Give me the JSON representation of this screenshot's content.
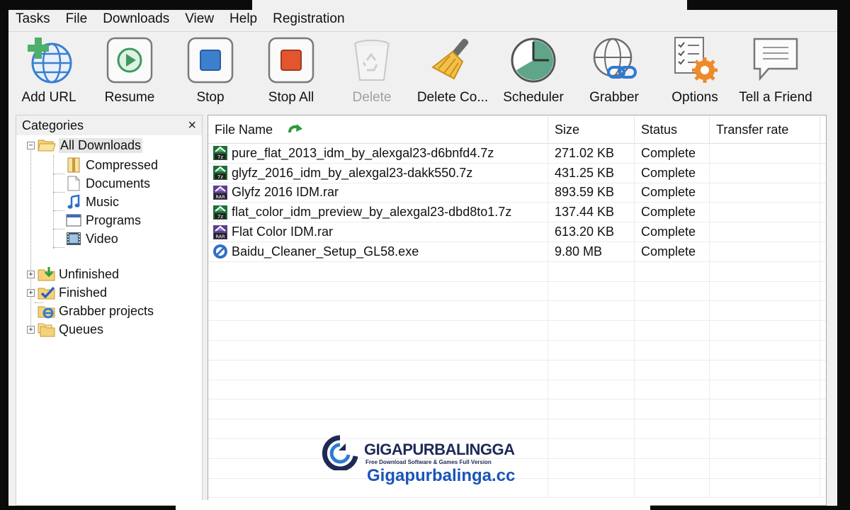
{
  "menu": [
    "Tasks",
    "File",
    "Downloads",
    "View",
    "Help",
    "Registration"
  ],
  "toolbar": [
    {
      "label": "Add URL",
      "icon": "add-url-globe-icon",
      "enabled": true
    },
    {
      "label": "Resume",
      "icon": "resume-play-icon",
      "enabled": true
    },
    {
      "label": "Stop",
      "icon": "stop-icon",
      "enabled": true
    },
    {
      "label": "Stop All",
      "icon": "stop-all-icon",
      "enabled": true
    },
    {
      "label": "Delete",
      "icon": "recycle-bin-icon",
      "enabled": false
    },
    {
      "label": "Delete Co...",
      "icon": "broom-icon",
      "enabled": true
    },
    {
      "label": "Scheduler",
      "icon": "clock-icon",
      "enabled": true
    },
    {
      "label": "Grabber",
      "icon": "globe-link-icon",
      "enabled": true
    },
    {
      "label": "Options",
      "icon": "checklist-gear-icon",
      "enabled": true
    },
    {
      "label": "Tell a Friend",
      "icon": "speech-bubble-icon",
      "enabled": true
    }
  ],
  "categories": {
    "title": "Categories",
    "close": "×",
    "items": [
      {
        "label": "All Downloads",
        "icon": "open-folder-icon",
        "selected": true
      },
      {
        "label": "Compressed",
        "icon": "zip-file-icon"
      },
      {
        "label": "Documents",
        "icon": "document-icon"
      },
      {
        "label": "Music",
        "icon": "music-note-icon"
      },
      {
        "label": "Programs",
        "icon": "program-window-icon"
      },
      {
        "label": "Video",
        "icon": "film-icon"
      },
      {
        "label": "Unfinished",
        "icon": "folder-download-icon"
      },
      {
        "label": "Finished",
        "icon": "folder-check-icon"
      },
      {
        "label": "Grabber projects",
        "icon": "folder-ie-icon"
      },
      {
        "label": "Queues",
        "icon": "folder-stack-icon"
      }
    ]
  },
  "list": {
    "columns": [
      "File Name",
      "Size",
      "Status",
      "Transfer rate"
    ],
    "rows": [
      {
        "name": "pure_flat_2013_idm_by_alexgal23-d6bnfd4.7z",
        "size": "271.02  KB",
        "status": "Complete",
        "rate": "",
        "icon": "7z-archive-icon"
      },
      {
        "name": "glyfz_2016_idm_by_alexgal23-dakk550.7z",
        "size": "431.25  KB",
        "status": "Complete",
        "rate": "",
        "icon": "7z-archive-icon"
      },
      {
        "name": "Glyfz 2016 IDM.rar",
        "size": "893.59  KB",
        "status": "Complete",
        "rate": "",
        "icon": "rar-archive-icon"
      },
      {
        "name": "flat_color_idm_preview_by_alexgal23-dbd8to1.7z",
        "size": "137.44  KB",
        "status": "Complete",
        "rate": "",
        "icon": "7z-archive-icon"
      },
      {
        "name": "Flat Color IDM.rar",
        "size": "613.20  KB",
        "status": "Complete",
        "rate": "",
        "icon": "rar-archive-icon"
      },
      {
        "name": "Baidu_Cleaner_Setup_GL58.exe",
        "size": "9.80  MB",
        "status": "Complete",
        "rate": "",
        "icon": "exe-installer-icon"
      }
    ]
  },
  "watermark": {
    "brand_a": "GIGA",
    "brand_b": "PURBALINGGA",
    "tagline": "Free Download Software & Games Full Version",
    "url": "Gigapurbalinga.cc"
  },
  "colors": {
    "window_bg": "#f0f0f0",
    "watermark_blue": "#1a55b8",
    "watermark_navy": "#1d2a55"
  }
}
